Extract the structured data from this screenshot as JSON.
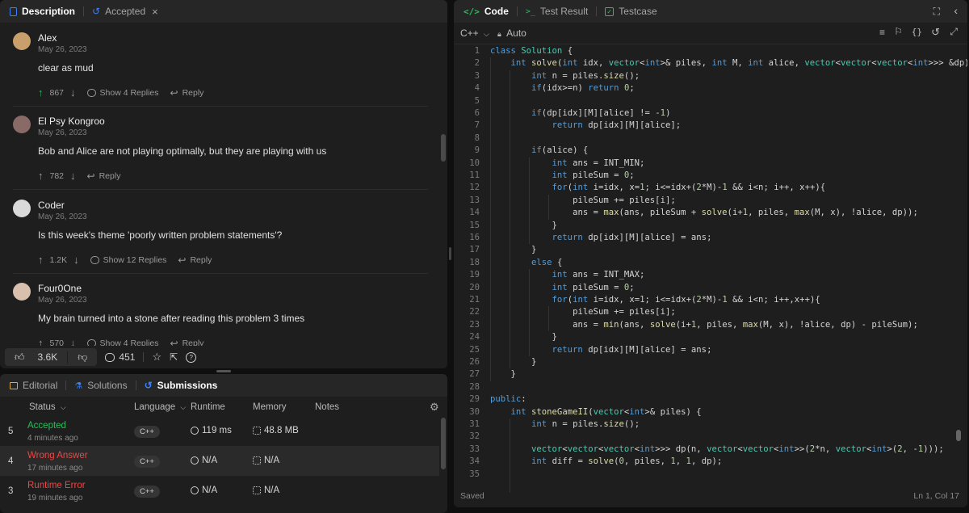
{
  "left_tabs": [
    {
      "label": "Description",
      "active": true
    },
    {
      "label": "Accepted",
      "active": false
    }
  ],
  "comments": [
    {
      "name": "Alex",
      "date": "May 26, 2023",
      "text": "clear as mud",
      "votes": "867",
      "replies": "Show 4 Replies",
      "reply": "Reply",
      "avatar_color": "#c9a06b",
      "upvoted": true
    },
    {
      "name": "El Psy Kongroo",
      "date": "May 26, 2023",
      "text": "Bob and Alice are not playing optimally, but they are playing with us",
      "votes": "782",
      "replies": "",
      "reply": "Reply",
      "avatar_color": "#8a6a66",
      "upvoted": false
    },
    {
      "name": "Coder",
      "date": "May 26, 2023",
      "text": "Is this week's theme 'poorly written problem statements'?",
      "votes": "1.2K",
      "replies": "Show 12 Replies",
      "reply": "Reply",
      "avatar_color": "#d9d9d9",
      "upvoted": false
    },
    {
      "name": "Four0One",
      "date": "May 26, 2023",
      "text": "My brain turned into a stone after reading this problem 3 times",
      "votes": "570",
      "replies": "Show 4 Replies",
      "reply": "Reply",
      "avatar_color": "#d8bfae",
      "upvoted": false
    }
  ],
  "desc_footer": {
    "likes": "3.6K",
    "comments": "451"
  },
  "bottom_tabs": [
    {
      "label": "Editorial"
    },
    {
      "label": "Solutions"
    },
    {
      "label": "Submissions",
      "active": true
    }
  ],
  "table": {
    "headers": {
      "status": "Status",
      "language": "Language",
      "runtime": "Runtime",
      "memory": "Memory",
      "notes": "Notes"
    },
    "rows": [
      {
        "idx": "5",
        "status": "Accepted",
        "color": "#2cbb5d",
        "ago": "4 minutes ago",
        "lang": "C++",
        "runtime": "119 ms",
        "memory": "48.8 MB"
      },
      {
        "idx": "4",
        "status": "Wrong Answer",
        "color": "#ef4743",
        "ago": "17 minutes ago",
        "lang": "C++",
        "runtime": "N/A",
        "memory": "N/A"
      },
      {
        "idx": "3",
        "status": "Runtime Error",
        "color": "#ef4743",
        "ago": "19 minutes ago",
        "lang": "C++",
        "runtime": "N/A",
        "memory": "N/A"
      }
    ]
  },
  "editor": {
    "tabs": [
      {
        "label": "Code",
        "active": true
      },
      {
        "label": "Test Result"
      },
      {
        "label": "Testcase"
      }
    ],
    "language": "C++",
    "mode": "Auto",
    "status_left": "Saved",
    "status_right": "Ln 1, Col 17",
    "lines": [
      "class Solution {",
      "    int solve(int idx, vector<int>& piles, int M, int alice, vector<vector<vector<int>>> &dp) {",
      "        int n = piles.size();",
      "        if(idx>=n) return 0;",
      "",
      "        if(dp[idx][M][alice] != -1)",
      "            return dp[idx][M][alice];",
      "",
      "        if(alice) {",
      "            int ans = INT_MIN;",
      "            int pileSum = 0;",
      "            for(int i=idx, x=1; i<=idx+(2*M)-1 && i<n; i++, x++){",
      "                pileSum += piles[i];",
      "                ans = max(ans, pileSum + solve(i+1, piles, max(M, x), !alice, dp));",
      "            }",
      "            return dp[idx][M][alice] = ans;",
      "        }",
      "        else {",
      "            int ans = INT_MAX;",
      "            int pileSum = 0;",
      "            for(int i=idx, x=1; i<=idx+(2*M)-1 && i<n; i++,x++){",
      "                pileSum += piles[i];",
      "                ans = min(ans, solve(i+1, piles, max(M, x), !alice, dp) - pileSum);",
      "            }",
      "            return dp[idx][M][alice] = ans;",
      "        }",
      "    }",
      "",
      "public:",
      "    int stoneGameII(vector<int>& piles) {",
      "        int n = piles.size();",
      "",
      "        vector<vector<vector<int>>> dp(n, vector<vector<int>>(2*n, vector<int>(2, -1)));",
      "        int diff = solve(0, piles, 1, 1, dp);",
      ""
    ]
  }
}
